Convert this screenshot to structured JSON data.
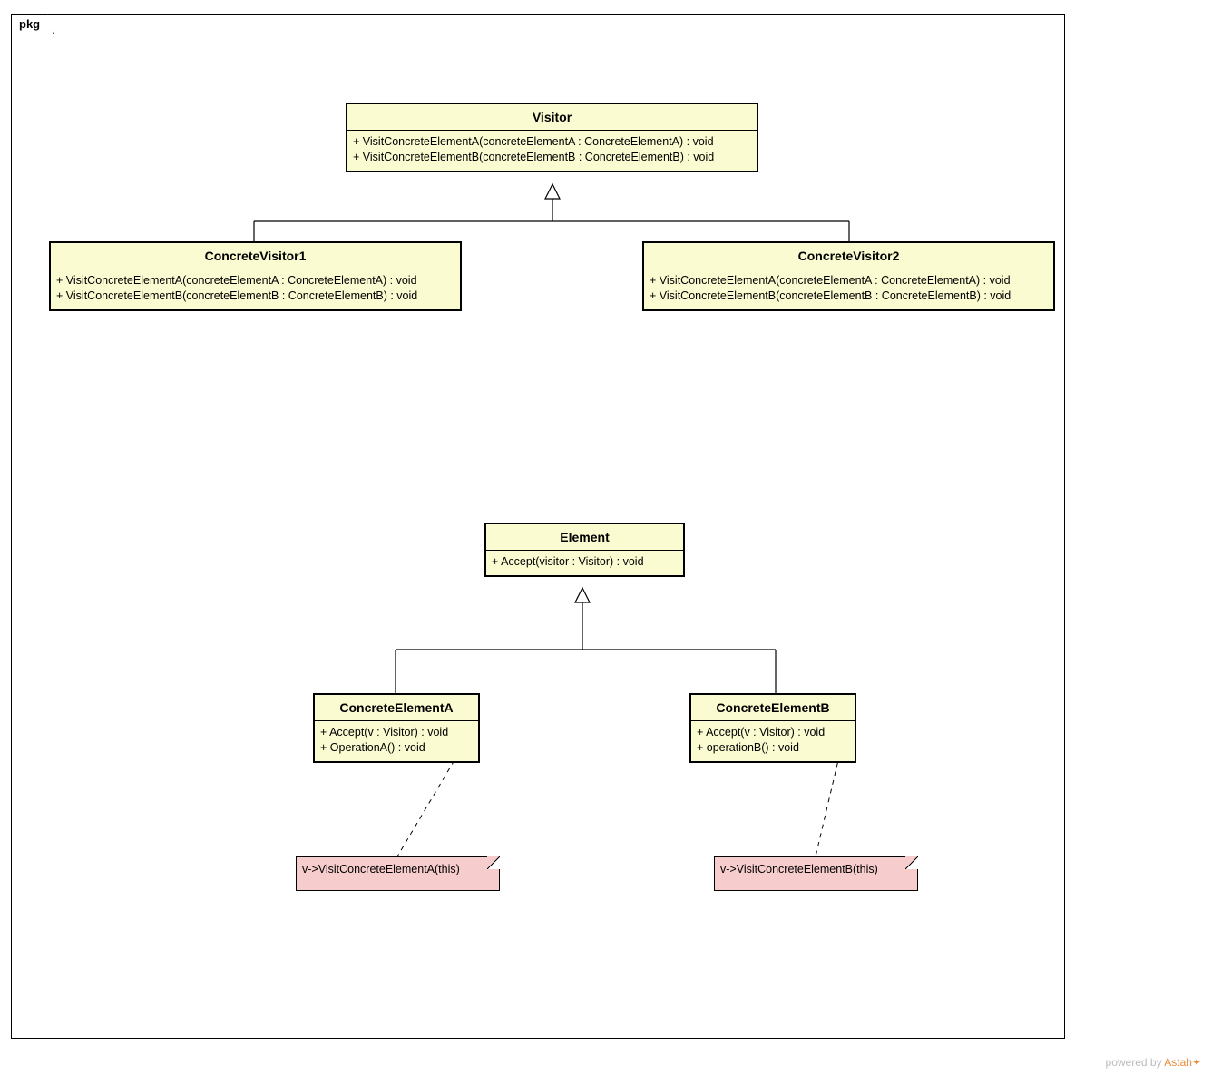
{
  "package": {
    "label": "pkg"
  },
  "classes": {
    "visitor": {
      "name": "Visitor",
      "ops": [
        "+ VisitConcreteElementA(concreteElementA : ConcreteElementA) : void",
        "+ VisitConcreteElementB(concreteElementB : ConcreteElementB) : void"
      ]
    },
    "cv1": {
      "name": "ConcreteVisitor1",
      "ops": [
        "+ VisitConcreteElementA(concreteElementA : ConcreteElementA) : void",
        "+ VisitConcreteElementB(concreteElementB : ConcreteElementB) : void"
      ]
    },
    "cv2": {
      "name": "ConcreteVisitor2",
      "ops": [
        "+ VisitConcreteElementA(concreteElementA : ConcreteElementA) : void",
        "+ VisitConcreteElementB(concreteElementB : ConcreteElementB) : void"
      ]
    },
    "element": {
      "name": "Element",
      "ops": [
        "+ Accept(visitor : Visitor) : void"
      ]
    },
    "ceA": {
      "name": "ConcreteElementA",
      "ops": [
        "+ Accept(v : Visitor) : void",
        "+ OperationA() : void"
      ]
    },
    "ceB": {
      "name": "ConcreteElementB",
      "ops": [
        "+ Accept(v : Visitor) : void",
        "+ operationB() : void"
      ]
    }
  },
  "notes": {
    "nA": "v->VisitConcreteElementA(this)",
    "nB": "v->VisitConcreteElementB(this)"
  },
  "footer": {
    "text": "powered by ",
    "brand": "Astah"
  }
}
